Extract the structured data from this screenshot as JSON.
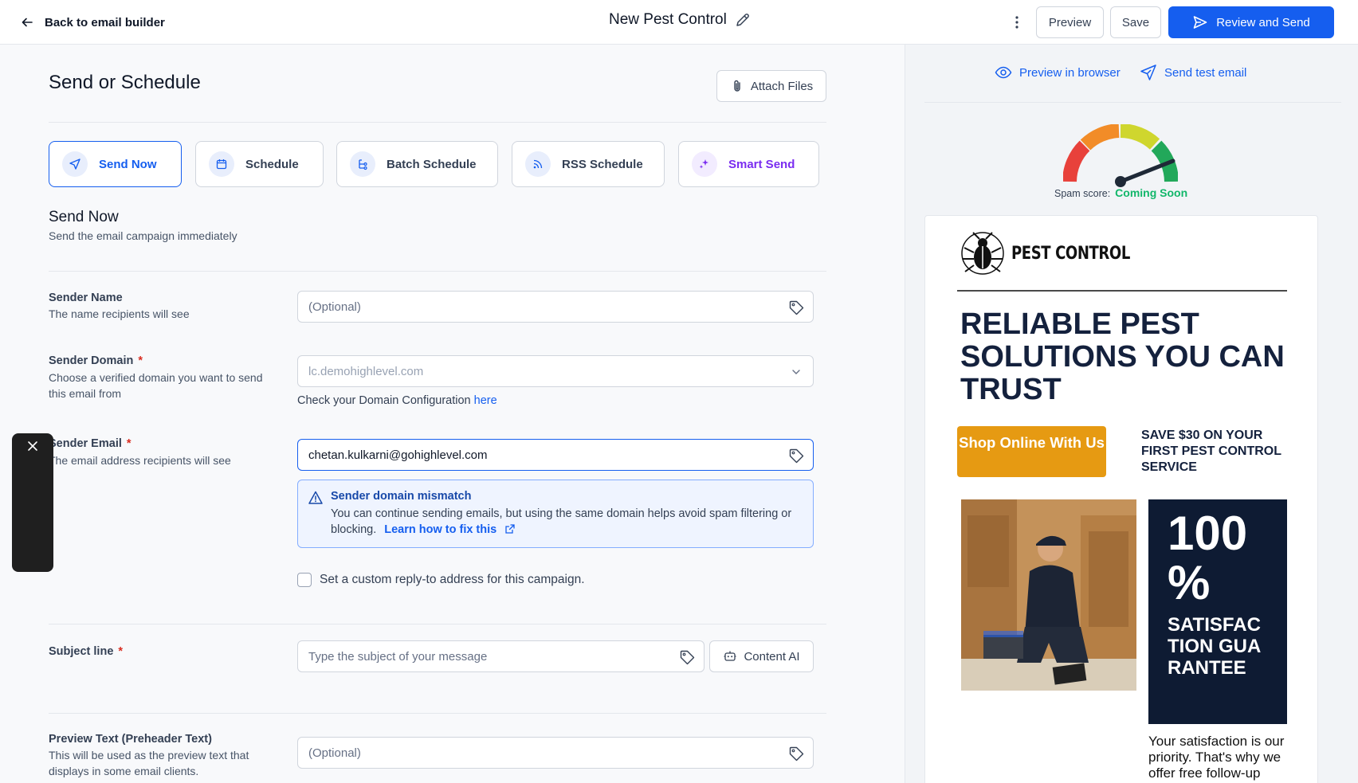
{
  "header": {
    "back_label": "Back to email builder",
    "title": "New Pest Control",
    "preview_label": "Preview",
    "save_label": "Save",
    "review_label": "Review and Send"
  },
  "left": {
    "section_title": "Send or Schedule",
    "attach_label": "Attach Files",
    "tabs": [
      {
        "label": "Send Now",
        "icon": "send-icon",
        "active": true
      },
      {
        "label": "Schedule",
        "icon": "calendar-icon",
        "active": false
      },
      {
        "label": "Batch Schedule",
        "icon": "batch-icon",
        "active": false
      },
      {
        "label": "RSS Schedule",
        "icon": "rss-icon",
        "active": false
      },
      {
        "label": "Smart Send",
        "icon": "sparkle-icon",
        "active": false
      }
    ],
    "send_now_heading": "Send Now",
    "send_now_sub": "Send the email campaign immediately",
    "sender_name": {
      "label": "Sender Name",
      "help": "The name recipients will see",
      "placeholder": "(Optional)",
      "value": ""
    },
    "sender_domain": {
      "label": "Sender Domain",
      "required": "*",
      "help": "Choose a verified domain you want to send this email from",
      "value": "lc.demohighlevel.com",
      "note_text": "Check your Domain Configuration ",
      "note_link": "here"
    },
    "sender_email": {
      "label": "Sender Email",
      "required": "*",
      "help": "The email address recipients will see",
      "value": "chetan.kulkarni@gohighlevel.com"
    },
    "warning": {
      "title": "Sender domain mismatch",
      "text": "You can continue sending emails, but using the same domain helps avoid spam filtering or blocking.",
      "link": "Learn how to fix this"
    },
    "reply_to_label": "Set a custom reply-to address for this campaign.",
    "subject": {
      "label": "Subject line",
      "required": "*",
      "placeholder": "Type the subject of your message",
      "content_ai_label": "Content AI"
    },
    "preview_text": {
      "label": "Preview Text (Preheader Text)",
      "help": "This will be used as the preview text that displays in some email clients.",
      "placeholder": "(Optional)"
    }
  },
  "right": {
    "preview_browser_label": "Preview in browser",
    "send_test_label": "Send test email",
    "spam_label": "Spam score:",
    "spam_value": "Coming Soon",
    "email": {
      "logo_text": "PEST CONTROL",
      "headline": "RELIABLE PEST SOLUTIONS YOU CAN TRUST",
      "shop_button": "Shop Online With Us",
      "save_text": "SAVE $30 ON YOUR FIRST PEST CONTROL SERVICE",
      "guarantee_big": "100 %",
      "guarantee_small": "SATISFACTION GUARANTEE",
      "satisfaction_text": "Your satisfaction is our priority. That's why we offer free follow-up"
    }
  },
  "colors": {
    "primary": "#155eef",
    "smart_send": "#7a2cf0",
    "shop_button": "#e69a12",
    "guarantee_bg": "#0e1b33",
    "spam_coming_soon": "#12b76a"
  }
}
